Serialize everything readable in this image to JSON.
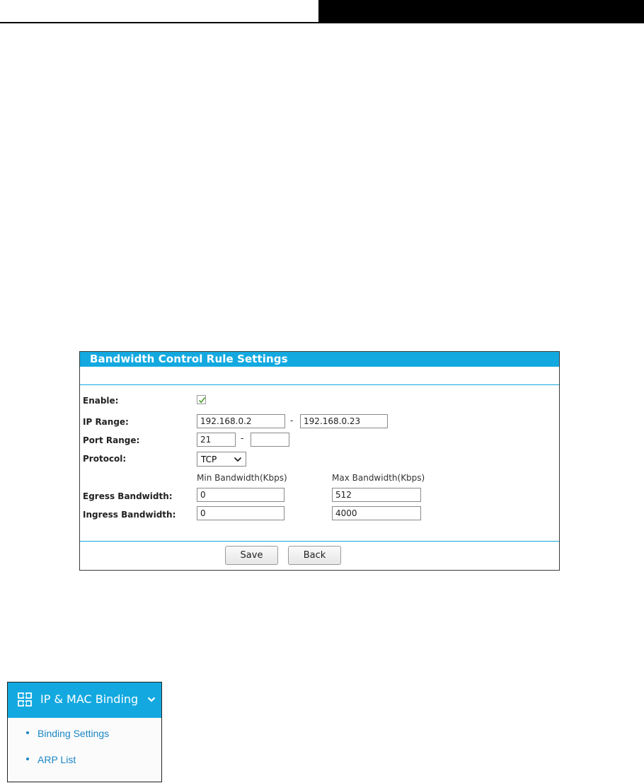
{
  "panel": {
    "title": "Bandwidth Control Rule Settings",
    "labels": {
      "enable": "Enable:",
      "ip_range": "IP Range:",
      "port_range": "Port Range:",
      "protocol": "Protocol:",
      "egress": "Egress Bandwidth:",
      "ingress": "Ingress Bandwidth:"
    },
    "enable_checked": true,
    "ip_start": "192.168.0.2",
    "ip_end": "192.168.0.23",
    "port_start": "21",
    "port_end": "",
    "dash": "-",
    "protocol_value": "TCP",
    "col_min": "Min Bandwidth(Kbps)",
    "col_max": "Max Bandwidth(Kbps)",
    "egress_min": "0",
    "egress_max": "512",
    "ingress_min": "0",
    "ingress_max": "4000",
    "save_label": "Save",
    "back_label": "Back"
  },
  "menu": {
    "title": "IP & MAC Binding",
    "items": [
      {
        "label": "Binding Settings"
      },
      {
        "label": "ARP List"
      }
    ]
  },
  "colors": {
    "accent": "#13a9e0",
    "link": "#1a86c4"
  },
  "icons": {
    "menu": "binding-icon",
    "chevron": "chevron-down-icon",
    "check": "check-icon",
    "select": "dropdown-chevron-icon"
  }
}
